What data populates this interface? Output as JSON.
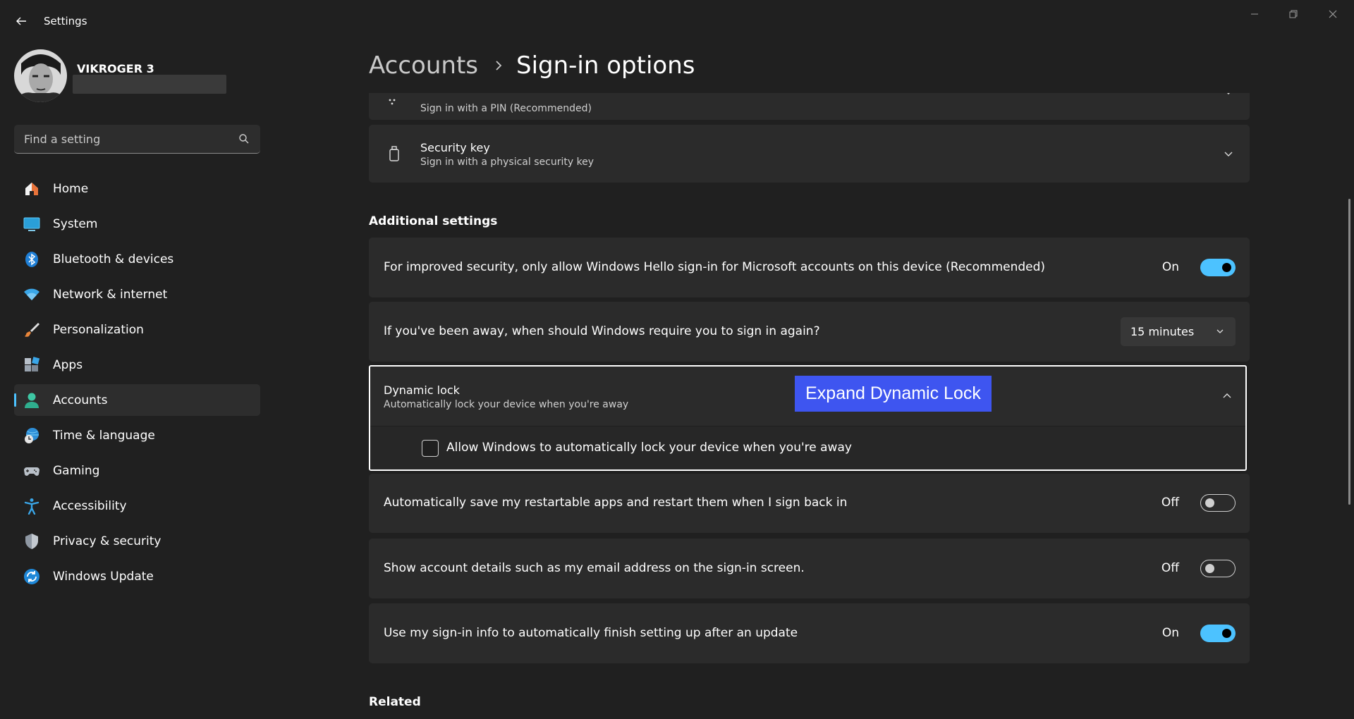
{
  "app": {
    "title": "Settings"
  },
  "profile": {
    "name": "VIKROGER 3"
  },
  "search": {
    "placeholder": "Find a setting"
  },
  "sidebar": {
    "items": [
      {
        "label": "Home",
        "icon": "home-icon"
      },
      {
        "label": "System",
        "icon": "system-icon"
      },
      {
        "label": "Bluetooth & devices",
        "icon": "bluetooth-icon"
      },
      {
        "label": "Network & internet",
        "icon": "wifi-icon"
      },
      {
        "label": "Personalization",
        "icon": "brush-icon"
      },
      {
        "label": "Apps",
        "icon": "apps-icon"
      },
      {
        "label": "Accounts",
        "icon": "accounts-icon",
        "active": true
      },
      {
        "label": "Time & language",
        "icon": "globe-clock-icon"
      },
      {
        "label": "Gaming",
        "icon": "gamepad-icon"
      },
      {
        "label": "Accessibility",
        "icon": "accessibility-icon"
      },
      {
        "label": "Privacy & security",
        "icon": "shield-icon"
      },
      {
        "label": "Windows Update",
        "icon": "update-icon"
      }
    ]
  },
  "breadcrumb": {
    "parent": "Accounts",
    "current": "Sign-in options"
  },
  "signin_methods": {
    "pin": {
      "subtitle": "Sign in with a PIN (Recommended)"
    },
    "security_key": {
      "title": "Security key",
      "subtitle": "Sign in with a physical security key"
    }
  },
  "additional": {
    "heading": "Additional settings",
    "hello_only": {
      "label": "For improved security, only allow Windows Hello sign-in for Microsoft accounts on this device (Recommended)",
      "state": "On"
    },
    "away": {
      "label": "If you've been away, when should Windows require you to sign in again?",
      "value": "15 minutes"
    },
    "dynamic_lock": {
      "title": "Dynamic lock",
      "subtitle": "Automatically lock your device when you're away",
      "checkbox_label": "Allow Windows to automatically lock your device when you're away"
    },
    "restart_apps": {
      "label": "Automatically save my restartable apps and restart them when I sign back in",
      "state": "Off"
    },
    "account_details": {
      "label": "Show account details such as my email address on the sign-in screen.",
      "state": "Off"
    },
    "signin_info": {
      "label": "Use my sign-in info to automatically finish setting up after an update",
      "state": "On"
    }
  },
  "related": {
    "heading": "Related"
  },
  "annotation": {
    "label": "Expand Dynamic Lock"
  },
  "colors": {
    "accent": "#4cc2ff",
    "annotation": "#3e55f0",
    "card": "#2b2b2b",
    "background": "#202020"
  }
}
